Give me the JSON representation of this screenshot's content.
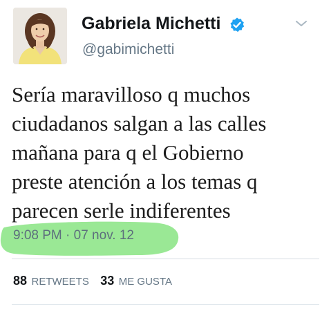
{
  "author": {
    "display_name": "Gabriela Michetti",
    "handle": "@gabimichetti",
    "verified": true
  },
  "tweet": {
    "text": "Sería maravilloso q muchos\nciudadanos salgan a las calles\nmañana para q el Gobierno\npreste atención a los temas q\nparecen serle indiferentes",
    "timestamp": "9:08 PM · 07 nov. 12"
  },
  "stats": {
    "retweets_count": "88",
    "retweets_label": "RETWEETS",
    "likes_count": "33",
    "likes_label": "ME GUSTA"
  },
  "icons": {
    "verified": "verified-badge-icon",
    "menu": "chevron-down-icon",
    "avatar": "profile-photo"
  },
  "colors": {
    "verified_blue": "#1da1f2",
    "highlight_green": "#8fe68a",
    "secondary_text": "#657786"
  }
}
